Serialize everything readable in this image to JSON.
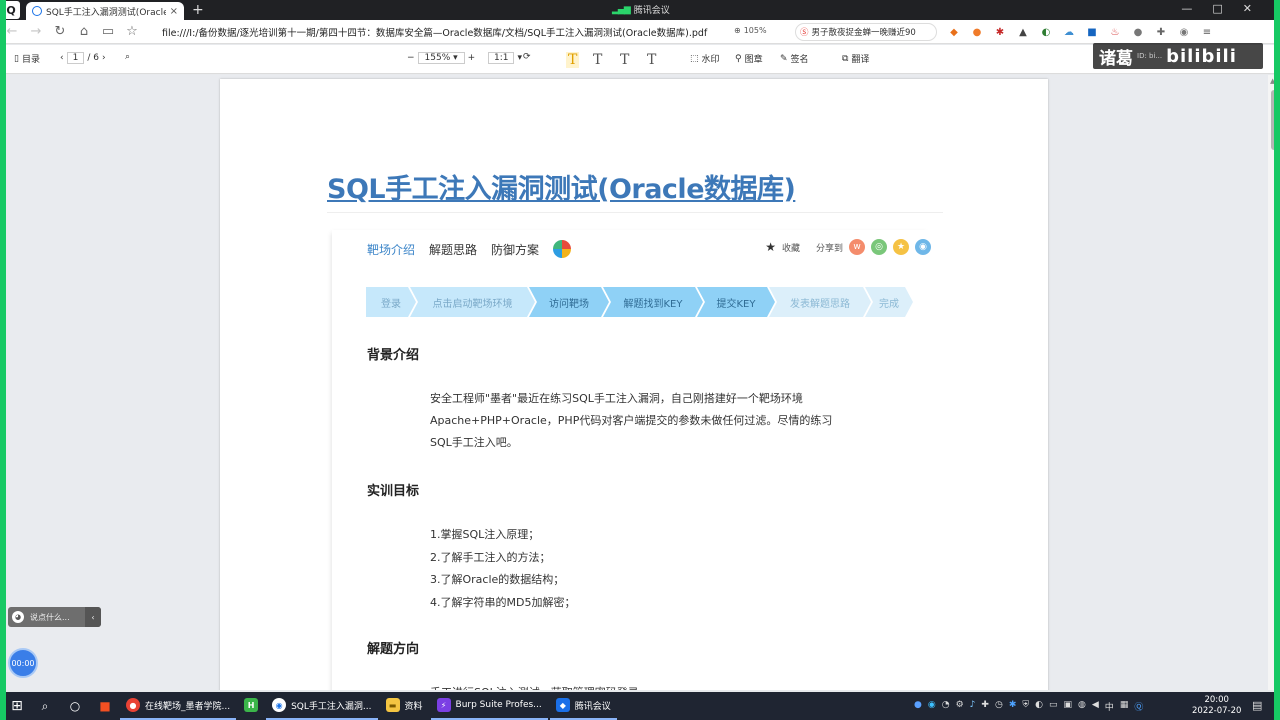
{
  "browser": {
    "tab_title": "SQL手工注入漏洞测试(Oracle数据库",
    "tab_close": "×",
    "new_tab": "+",
    "meeting_label": "腾讯会议",
    "url": "file:///I:/备份数据/逐光培训第十一期/第四十四节：数据库安全篇—Oracle数据库/文档/SQL手工注入漏洞测试(Oracle数据库).pdf",
    "zoom": "105%",
    "news_text": "男子散夜捉金蝉一晚赚近90",
    "nav_back": "←",
    "nav_forward": "→",
    "nav_reload": "↻",
    "nav_home": "⌂",
    "window_controls": [
      "—",
      "□",
      "✕"
    ]
  },
  "pdf_toolbar": {
    "toc_label": "目录",
    "page_current": "1",
    "page_total": "/ 6",
    "zoom_value": "155%",
    "zoom_minus": "−",
    "zoom_plus": "+",
    "fit_label": "1:1",
    "watermark_label": "水印",
    "stamp_label": "图章",
    "sign_label": "签名",
    "translate_label": "翻译"
  },
  "watermark": {
    "text": "诸葛",
    "logo": "bilibili",
    "id_text": "ID: bi..."
  },
  "document": {
    "title": "SQL手工注入漏洞测试(Oracle数据库)",
    "nav_tabs": [
      "靶场介绍",
      "解题思路",
      "防御方案"
    ],
    "favorite_label": "收藏",
    "share_label": "分享到",
    "steps": [
      "登录",
      "点击启动靶场环境",
      "访问靶场",
      "解题找到KEY",
      "提交KEY",
      "发表解题思路",
      "完成"
    ],
    "sections": {
      "background_heading": "背景介绍",
      "background_lines": [
        "安全工程师\"墨者\"最近在练习SQL手工注入漏洞，自己刚搭建好一个靶场环境",
        "Apache+PHP+Oracle，PHP代码对客户端提交的参数未做任何过滤。尽情的练习",
        "SQL手工注入吧。"
      ],
      "goals_heading": "实训目标",
      "goals": [
        "1.掌握SQL注入原理；",
        "2.了解手工注入的方法；",
        "3.了解Oracle的数据结构；",
        "4.了解字符串的MD5加解密；"
      ],
      "direction_heading": "解题方向",
      "direction_line": "手工进行SQL注入测试，获取管理密码登录。"
    }
  },
  "overlay": {
    "chat_placeholder": "说点什么...",
    "timer": "00:00"
  },
  "taskbar": {
    "apps": [
      "在线靶场_墨者学院...",
      "SQL手工注入漏洞...",
      "资料",
      "Burp Suite Profes...",
      "腾讯会议"
    ],
    "ime": "中",
    "time": "20:00",
    "date": "2022-07-20"
  }
}
